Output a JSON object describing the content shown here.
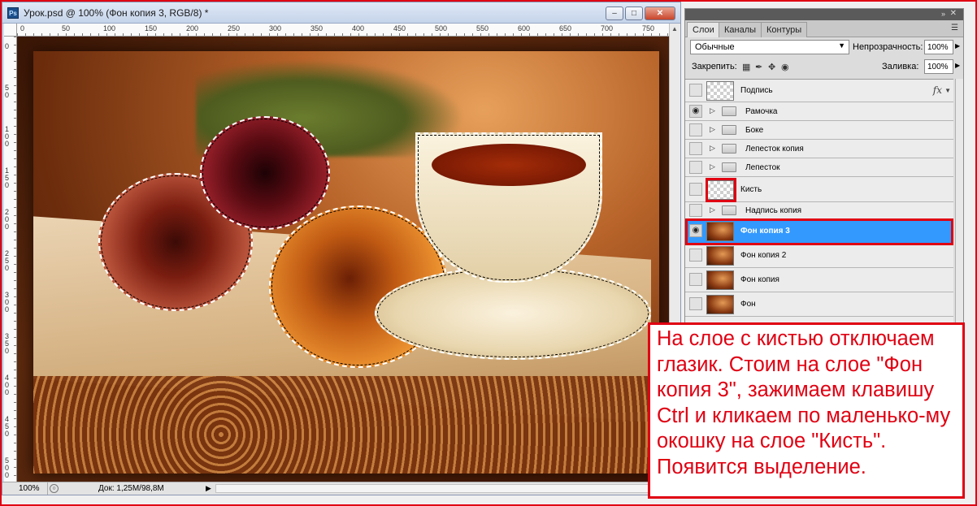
{
  "document": {
    "title": "Урок.psd @ 100% (Фон  копия 3, RGB/8) *",
    "app_icon": "Ps",
    "window_buttons": [
      "minimize",
      "maximize",
      "close"
    ],
    "ruler_h": [
      "0",
      "50",
      "100",
      "150",
      "200",
      "250",
      "300",
      "350",
      "400",
      "450",
      "500",
      "550",
      "600",
      "650",
      "700",
      "750"
    ],
    "ruler_v": [
      "0",
      "50",
      "100",
      "150",
      "200",
      "250",
      "300",
      "350",
      "400",
      "450",
      "500"
    ],
    "status": {
      "zoom": "100%",
      "doc_size": "Док: 1,25M/98,8M"
    }
  },
  "panel": {
    "tabs": [
      "Слои",
      "Каналы",
      "Контуры"
    ],
    "blend_mode": "Обычные",
    "opacity_label": "Непрозрачность:",
    "opacity_value": "100%",
    "lock_label": "Закрепить:",
    "fill_label": "Заливка:",
    "fill_value": "100%",
    "layers": [
      {
        "name": "Подпись",
        "kind": "layer",
        "visible": false,
        "fx": "fx"
      },
      {
        "name": "Рамочка",
        "kind": "group",
        "visible": true
      },
      {
        "name": "Боке",
        "kind": "group",
        "visible": false
      },
      {
        "name": "Лепесток копия",
        "kind": "group",
        "visible": false
      },
      {
        "name": "Лепесток",
        "kind": "group",
        "visible": false
      },
      {
        "name": "Кисть",
        "kind": "layer",
        "visible": false
      },
      {
        "name": "Надпись копия",
        "kind": "group",
        "visible": false
      },
      {
        "name": "Фон  копия 3",
        "kind": "photo",
        "visible": true,
        "selected": true
      },
      {
        "name": "Фон  копия 2",
        "kind": "photo",
        "visible": false
      },
      {
        "name": "Фон  копия",
        "kind": "photo",
        "visible": false
      },
      {
        "name": "Фон",
        "kind": "photo",
        "visible": false
      }
    ]
  },
  "note": {
    "text": "На слое с кистью отключаем глазик. Стоим на слое \"Фон копия 3\", зажимаем клавишу Ctrl и кликаем по маленько-му окошку на слое \"Кисть\". Появится выделение."
  },
  "colors": {
    "accent_red": "#e00012",
    "selection_blue": "#3399ff"
  }
}
